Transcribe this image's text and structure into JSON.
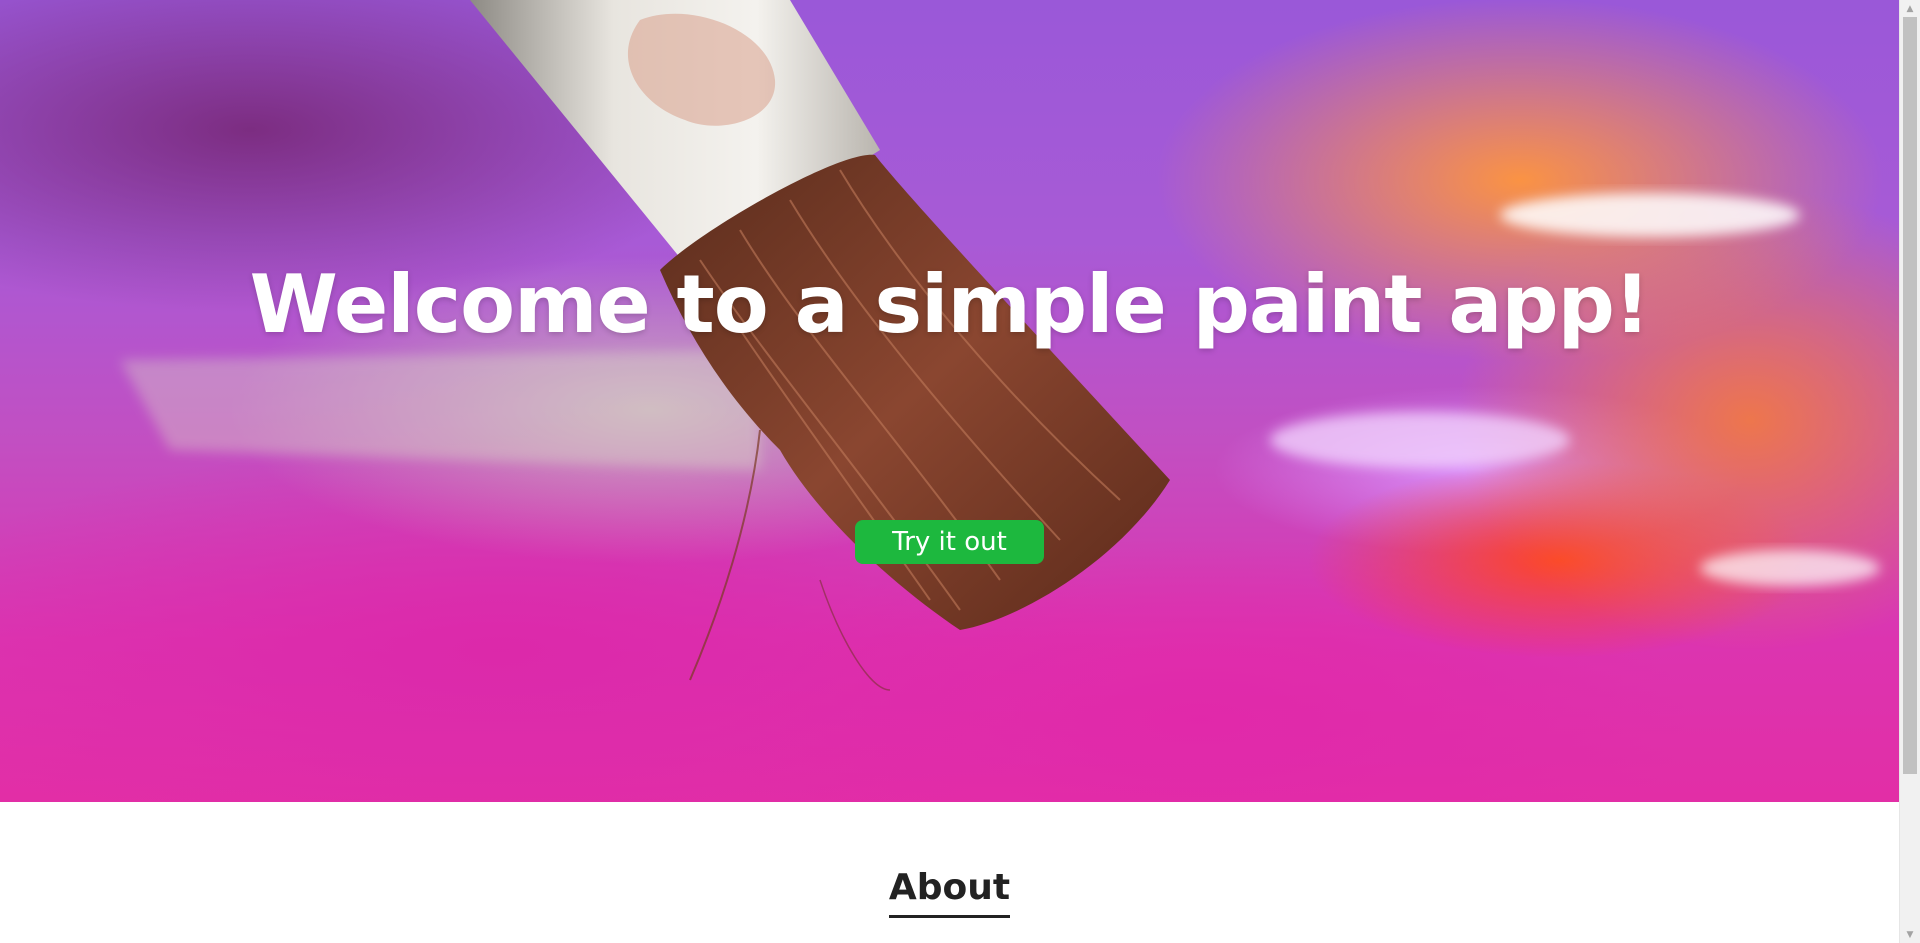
{
  "hero": {
    "title": "Welcome to a simple paint app!",
    "cta_label": "Try it out",
    "cta_color": "#1db83e"
  },
  "about": {
    "heading": "About"
  },
  "scrollbar": {
    "up_icon": "triangle-up",
    "down_icon": "triangle-down"
  }
}
